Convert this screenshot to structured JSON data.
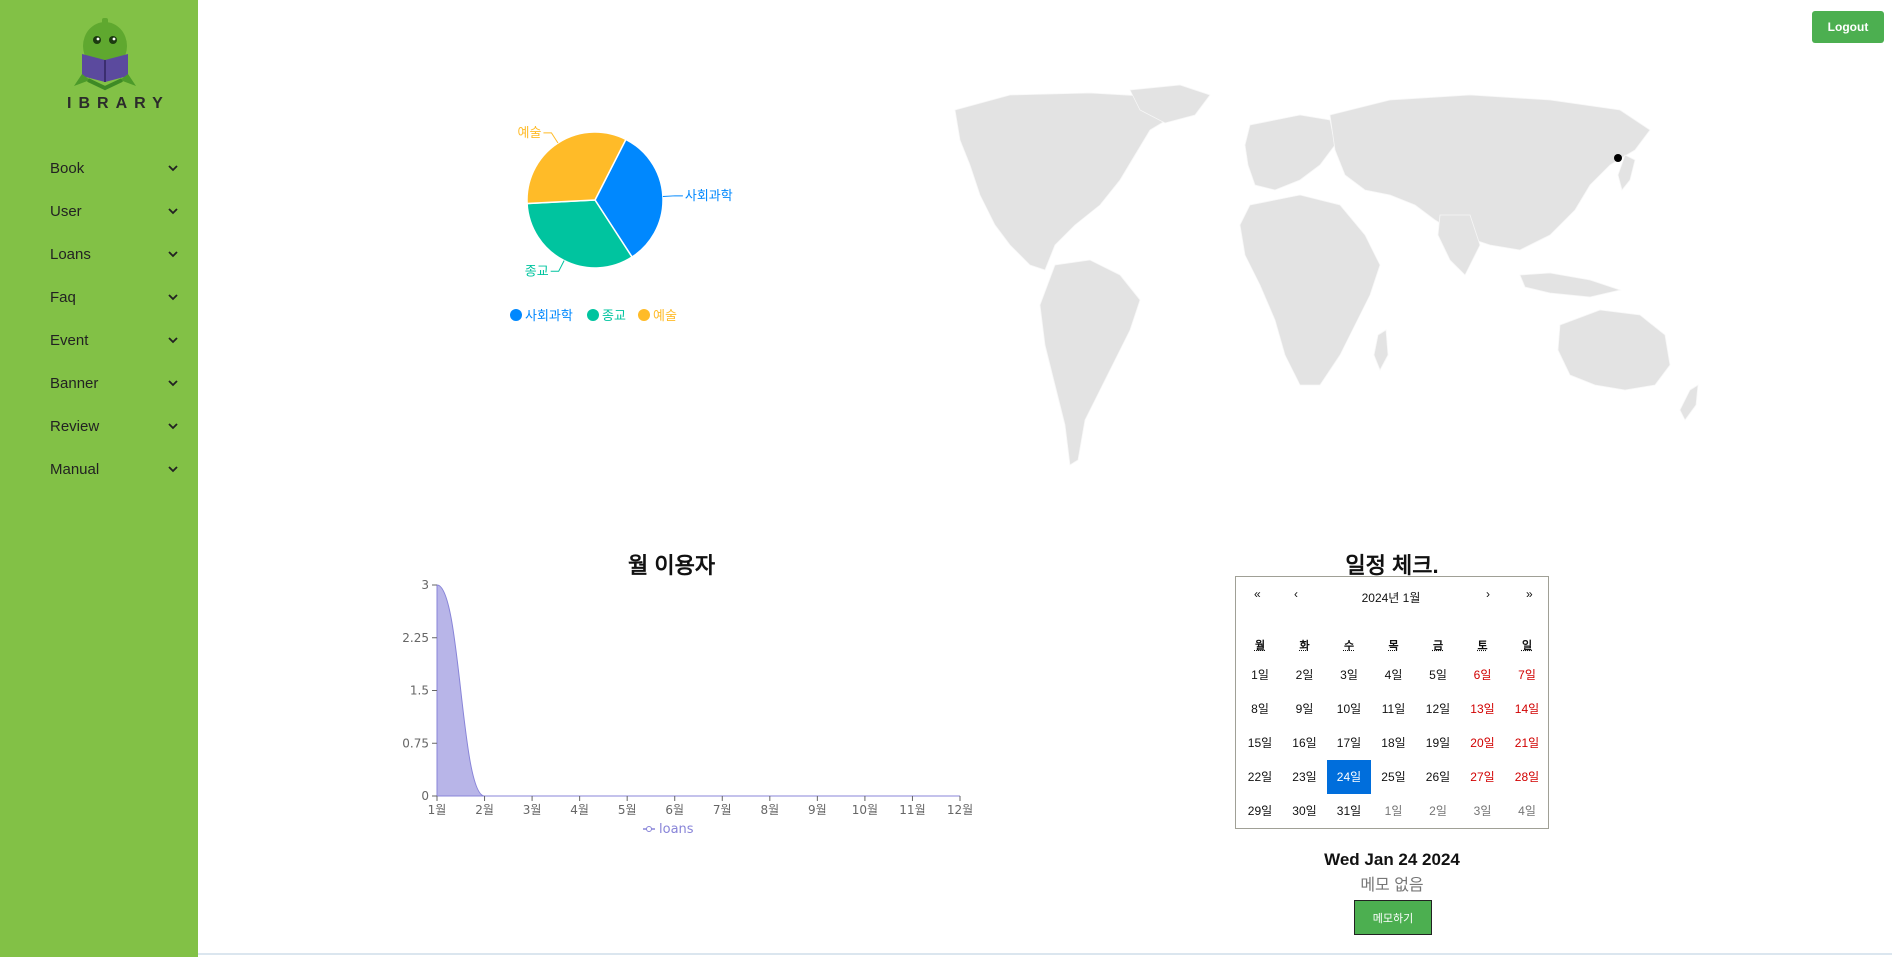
{
  "app": {
    "logo_text": "LIBRARY",
    "logout_label": "Logout"
  },
  "sidebar": {
    "items": [
      {
        "label": "Book"
      },
      {
        "label": "User"
      },
      {
        "label": "Loans"
      },
      {
        "label": "Faq"
      },
      {
        "label": "Event"
      },
      {
        "label": "Banner"
      },
      {
        "label": "Review"
      },
      {
        "label": "Manual"
      }
    ]
  },
  "colors": {
    "sidebar": "#82c146",
    "button": "#4caf50",
    "pie_blue": "#0088fe",
    "pie_teal": "#00c49f",
    "pie_yellow": "#ffbb28",
    "area": "#8884d8",
    "selected_day": "#006edc"
  },
  "chart_data": [
    {
      "type": "pie",
      "categories": [
        "사회과학",
        "종교",
        "예술"
      ],
      "values": [
        1,
        1,
        1
      ],
      "colors": [
        "#0088fe",
        "#00c49f",
        "#ffbb28"
      ],
      "legend": [
        "사회과학",
        "종교",
        "예술"
      ],
      "legend_position": "bottom"
    },
    {
      "type": "area",
      "title": "월 이용자",
      "categories": [
        "1월",
        "2월",
        "3월",
        "4월",
        "5월",
        "6월",
        "7월",
        "8월",
        "9월",
        "10월",
        "11월",
        "12월"
      ],
      "series": [
        {
          "name": "loans",
          "values": [
            3,
            0,
            0,
            0,
            0,
            0,
            0,
            0,
            0,
            0,
            0,
            0
          ]
        }
      ],
      "yticks": [
        "0",
        "0.75",
        "1.5",
        "2.25",
        "3"
      ],
      "ylim": [
        0,
        3
      ],
      "legend_position": "bottom"
    }
  ],
  "map": {
    "marker": "Seoul"
  },
  "calendar": {
    "heading": "일정 체크.",
    "title": "2024년 1월",
    "nav": {
      "first": "«",
      "prev": "‹",
      "next": "›",
      "last": "»"
    },
    "weekdays": [
      "월",
      "화",
      "수",
      "목",
      "금",
      "토",
      "일"
    ],
    "weeks": [
      [
        "1일",
        "2일",
        "3일",
        "4일",
        "5일",
        "6일",
        "7일"
      ],
      [
        "8일",
        "9일",
        "10일",
        "11일",
        "12일",
        "13일",
        "14일"
      ],
      [
        "15일",
        "16일",
        "17일",
        "18일",
        "19일",
        "20일",
        "21일"
      ],
      [
        "22일",
        "23일",
        "24일",
        "25일",
        "26일",
        "27일",
        "28일"
      ],
      [
        "29일",
        "30일",
        "31일",
        "1일",
        "2일",
        "3일",
        "4일"
      ]
    ],
    "selected": "24일",
    "selected_date_text": "Wed Jan 24 2024",
    "memo_empty_text": "메모 없음",
    "memo_button_label": "메모하기"
  }
}
